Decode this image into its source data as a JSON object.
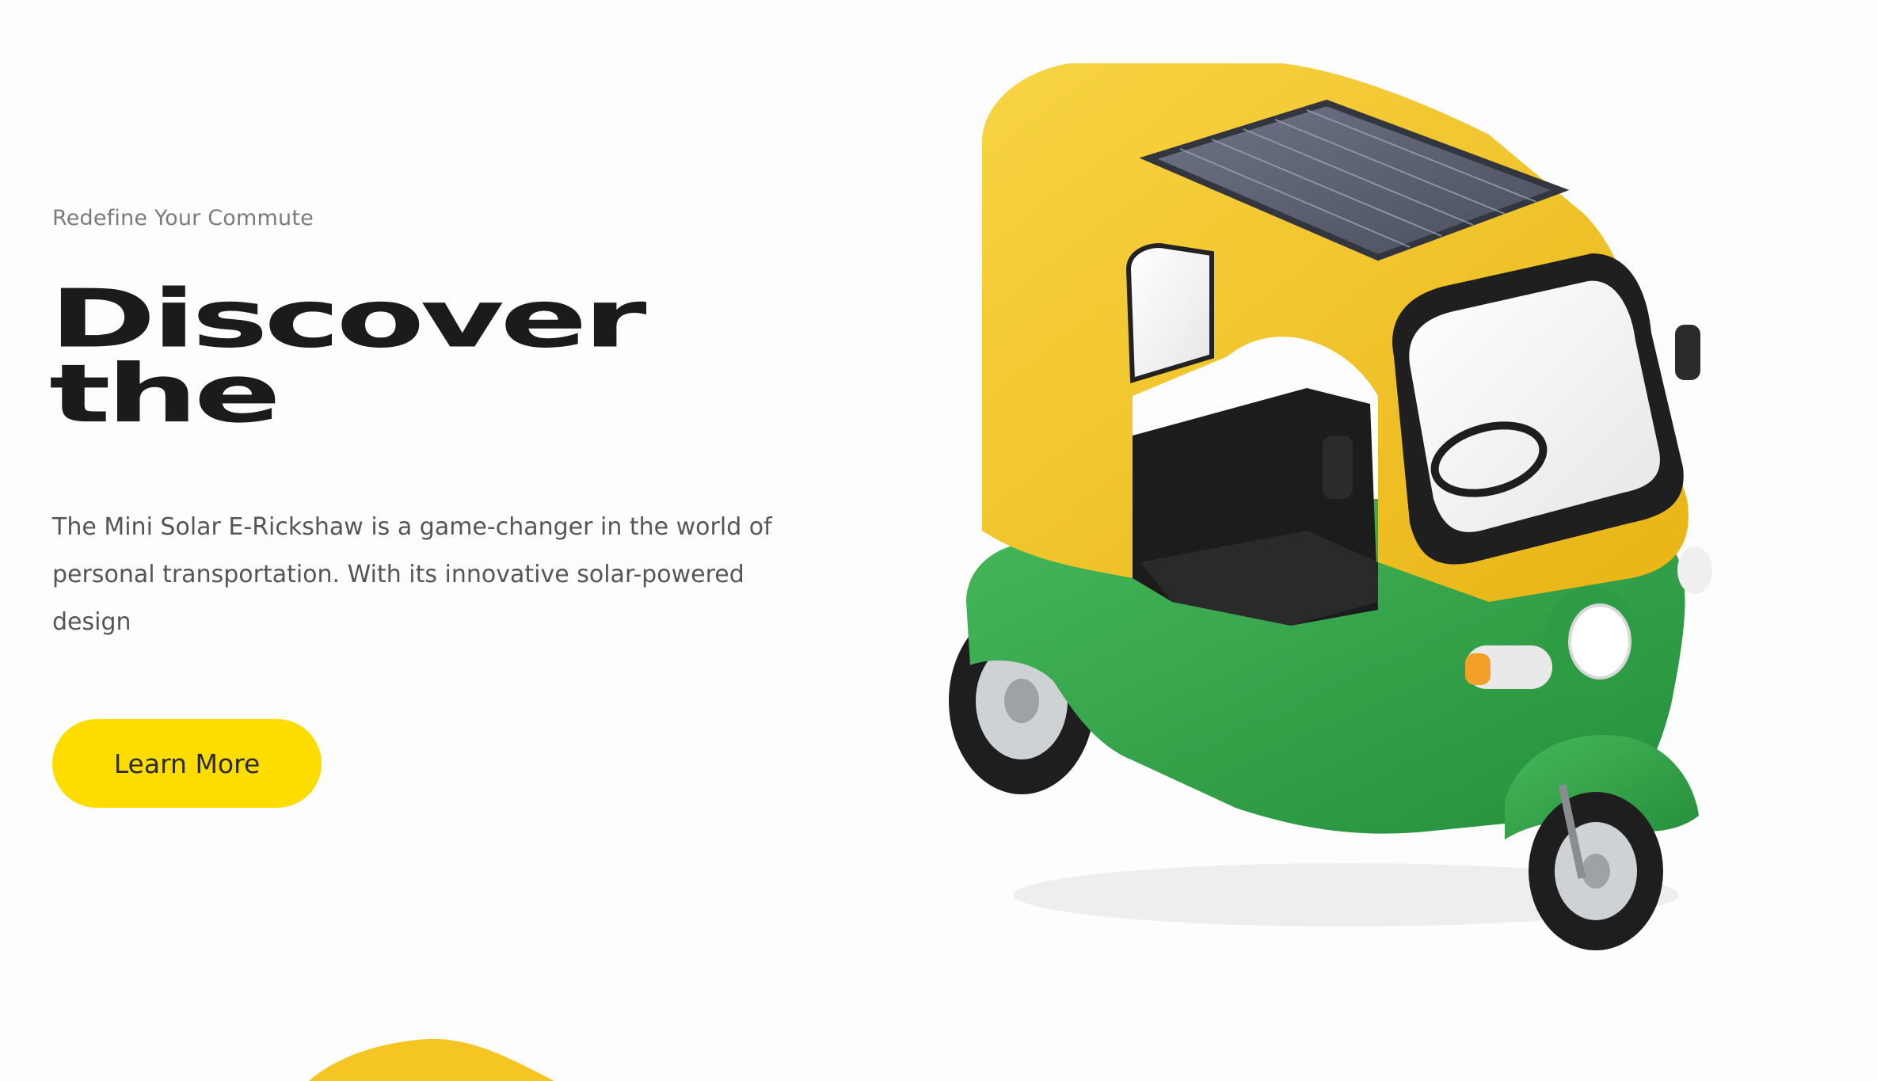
{
  "hero": {
    "eyebrow": "Redefine Your Commute",
    "headline_line1": "Discover",
    "headline_line2": "the",
    "description": "The Mini Solar E-Rickshaw is a game-changer in the world of personal transportation. With its innovative solar-powered design",
    "cta_label": "Learn More"
  },
  "colors": {
    "accent_yellow": "#FDDC00",
    "body_green": "#36A84E",
    "roof_yellow": "#F5C524",
    "text_dark": "#1b1b1b",
    "text_muted": "#7b7b7b"
  },
  "images": {
    "hero_image": "solar-e-rickshaw",
    "secondary_image": "rickshaw-roof-partial"
  }
}
